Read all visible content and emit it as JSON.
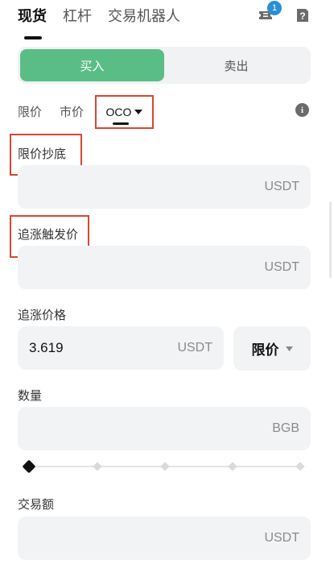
{
  "top_tabs": [
    "现货",
    "杠杆",
    "交易机器人"
  ],
  "notification_badge": "1",
  "side": {
    "buy": "买入",
    "sell": "卖出"
  },
  "order_types": {
    "limit": "限价",
    "market": "市价",
    "oco": "OCO"
  },
  "fields": {
    "limit_buy_label": "限价抄底",
    "limit_buy_unit": "USDT",
    "trigger_label": "追涨触发价",
    "trigger_unit": "USDT",
    "chase_price_label": "追涨价格",
    "chase_price_value": "3.619",
    "chase_price_unit": "USDT",
    "chase_price_type": "限价",
    "quantity_label": "数量",
    "quantity_unit": "BGB",
    "quantity_percent": 0,
    "amount_label": "交易额",
    "amount_unit": "USDT"
  },
  "colors": {
    "buy_active": "#5bbd86",
    "highlight_box": "#d9462e",
    "badge": "#2b8fd6"
  }
}
